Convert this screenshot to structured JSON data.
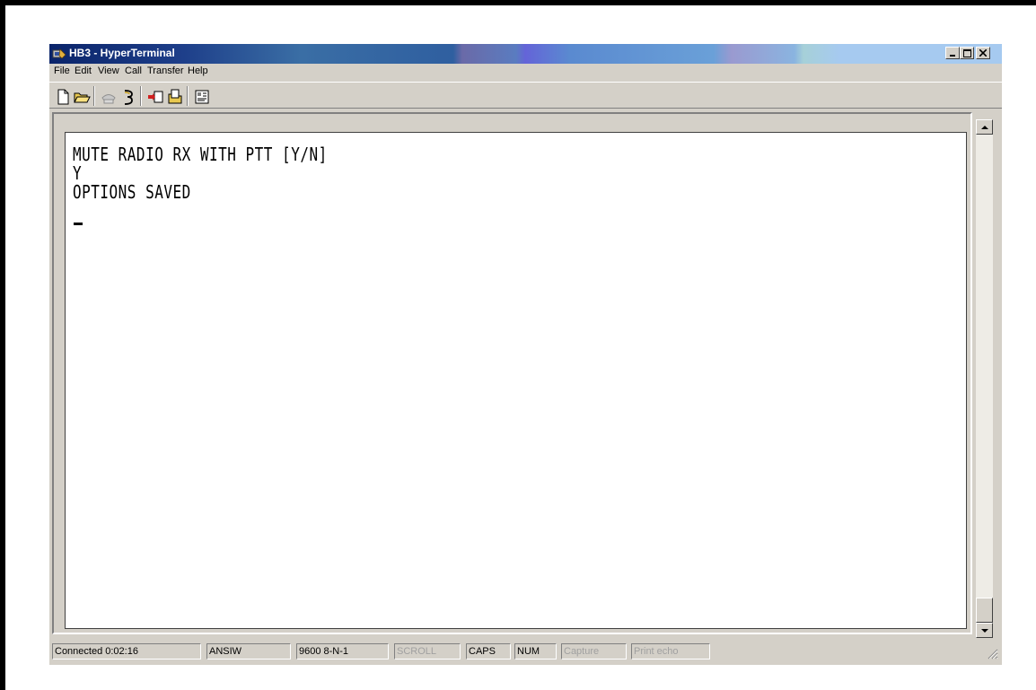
{
  "window": {
    "title": "HB3 - HyperTerminal"
  },
  "menu": [
    "File",
    "Edit",
    "View",
    "Call",
    "Transfer",
    "Help"
  ],
  "toolbar": {
    "icons": [
      "new-file-icon",
      "open-folder-icon",
      "disconnect-phone-icon",
      "connect-phone-icon",
      "send-file-icon",
      "receive-file-icon",
      "properties-icon"
    ]
  },
  "terminal": {
    "lines": [
      "MUTE RADIO RX WITH PTT [Y/N]",
      "Y",
      "OPTIONS SAVED"
    ]
  },
  "status": {
    "connection": "Connected 0:02:16",
    "emulation": "ANSIW",
    "port_settings": "9600 8-N-1",
    "scroll": "SCROLL",
    "caps": "CAPS",
    "num": "NUM",
    "capture": "Capture",
    "print_echo": "Print echo"
  },
  "colors": {
    "title_start": "#0a246a",
    "title_end": "#a6caf0",
    "chrome": "#d4d0c8"
  }
}
